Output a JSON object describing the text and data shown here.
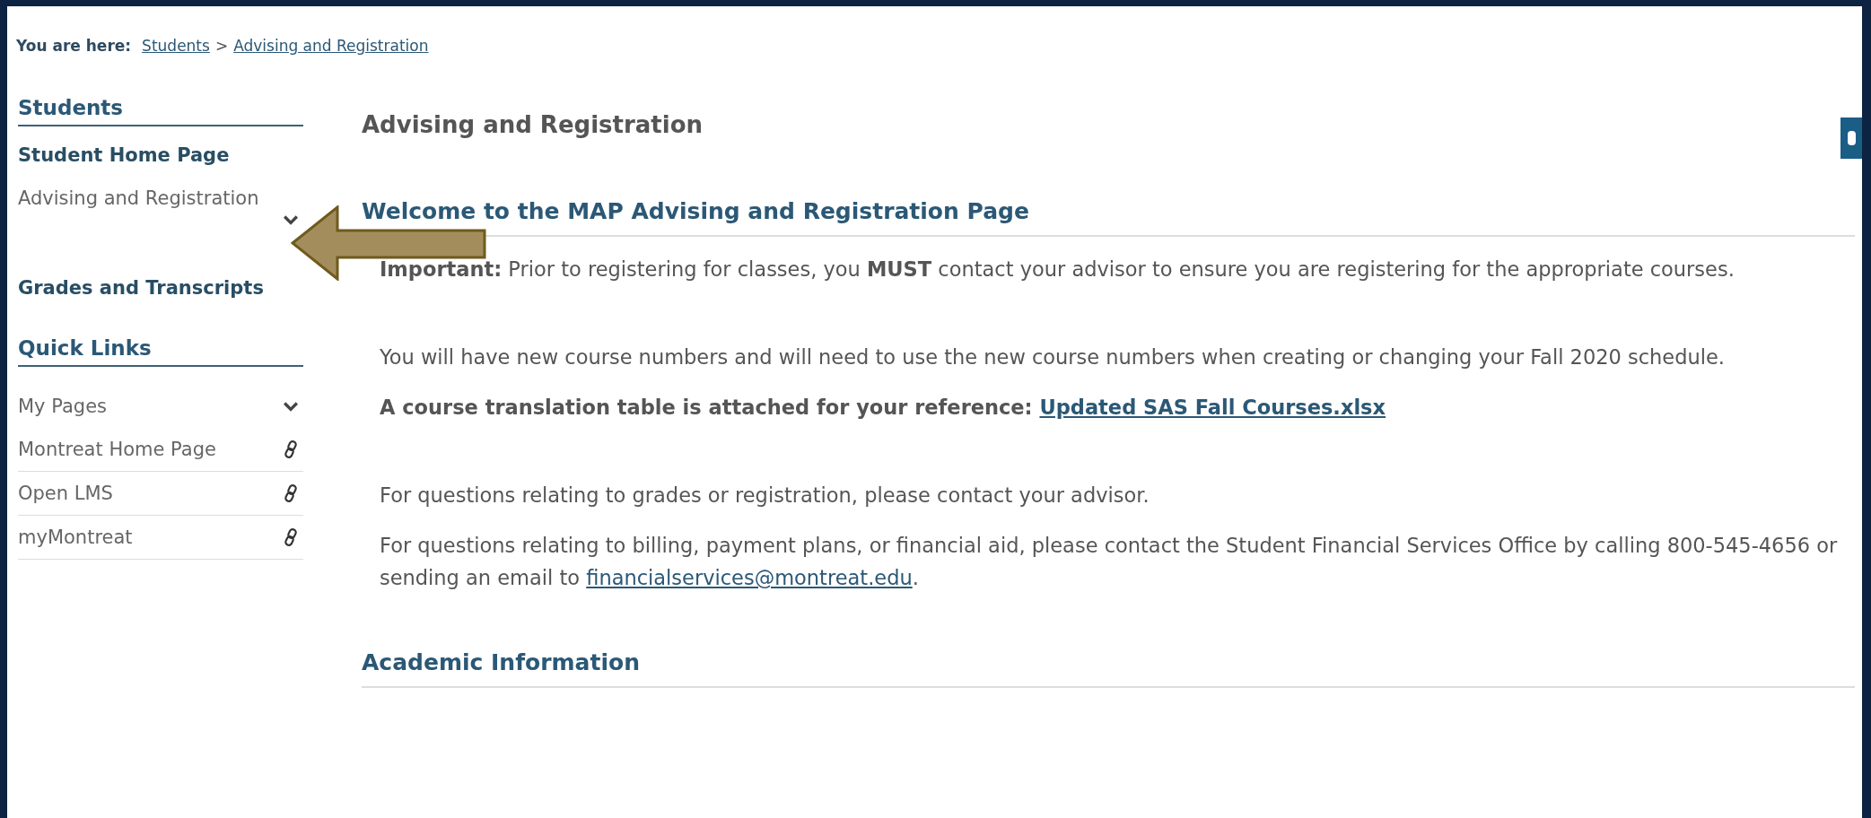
{
  "breadcrumb": {
    "label": "You are here:",
    "items": [
      {
        "label": "Students"
      },
      {
        "label": "Advising and Registration"
      }
    ],
    "separator": ">"
  },
  "sidebar": {
    "sections": [
      {
        "title": "Students",
        "items": [
          {
            "kind": "page",
            "label": "Student Home Page",
            "selected": false,
            "expandable": false
          },
          {
            "kind": "page",
            "label": "Advising and Registration",
            "selected": true,
            "expandable": true
          },
          {
            "kind": "page",
            "label": "Grades and Transcripts",
            "selected": false,
            "expandable": false
          }
        ]
      },
      {
        "title": "Quick Links",
        "items": [
          {
            "kind": "dropdown",
            "label": "My Pages"
          },
          {
            "kind": "link",
            "label": "Montreat Home Page"
          },
          {
            "kind": "link",
            "label": "Open LMS"
          },
          {
            "kind": "link",
            "label": "myMontreat"
          }
        ]
      }
    ]
  },
  "main": {
    "title": "Advising and Registration",
    "sections": [
      {
        "heading": "Welcome to the MAP Advising and Registration Page",
        "blocks": [
          [
            {
              "text": "**Important:** Prior to registering for classes, you **MUST** contact your advisor to ensure you are registering for the appropriate courses."
            }
          ],
          [
            {
              "text": "You will have new course numbers and will need to use the new course numbers when creating or changing your Fall 2020 schedule."
            },
            {
              "text": "A course translation table is attached for your reference:",
              "bold": true,
              "link": "Updated SAS Fall Courses.xlsx"
            }
          ],
          [
            {
              "text": "For questions relating to grades or registration, please contact your advisor."
            },
            {
              "text": "For questions relating to billing, payment plans, or financial aid, please contact the Student Financial Services Office by calling 800-545-4656 or sending an email to",
              "link": "financialservices@montreat.edu",
              "after": "."
            }
          ]
        ]
      },
      {
        "heading": "Academic Information"
      }
    ]
  }
}
